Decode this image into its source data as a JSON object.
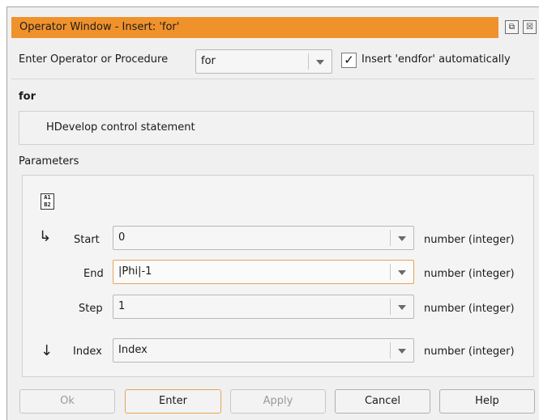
{
  "window": {
    "title": "Operator Window - Insert: 'for'",
    "title_icons": [
      {
        "name": "restore",
        "glyph": "⧉"
      },
      {
        "name": "close",
        "glyph": "☒"
      }
    ],
    "accent_color": "#f0922c"
  },
  "operator_row": {
    "label": "Enter Operator or Procedure",
    "combo_value": "for",
    "checkbox_checked": true,
    "checkbox_mark": "✓",
    "checkbox_label": "Insert 'endfor'  automatically"
  },
  "operator": {
    "name": "for",
    "description": "HDevelop control statement"
  },
  "parameters": {
    "heading": "Parameters",
    "rows": [
      {
        "label": "Start",
        "value": "0",
        "type": "number (integer)",
        "arrow": "↳"
      },
      {
        "label": "End",
        "value": "|Phi|-1",
        "type": "number (integer)",
        "arrow": ""
      },
      {
        "label": "Step",
        "value": "1",
        "type": "number (integer)",
        "arrow": ""
      },
      {
        "label": "Index",
        "value": "Index",
        "type": "number (integer)",
        "arrow": "↓"
      }
    ]
  },
  "buttons": {
    "ok": "Ok",
    "enter": "Enter",
    "apply": "Apply",
    "cancel": "Cancel",
    "help": "Help"
  }
}
